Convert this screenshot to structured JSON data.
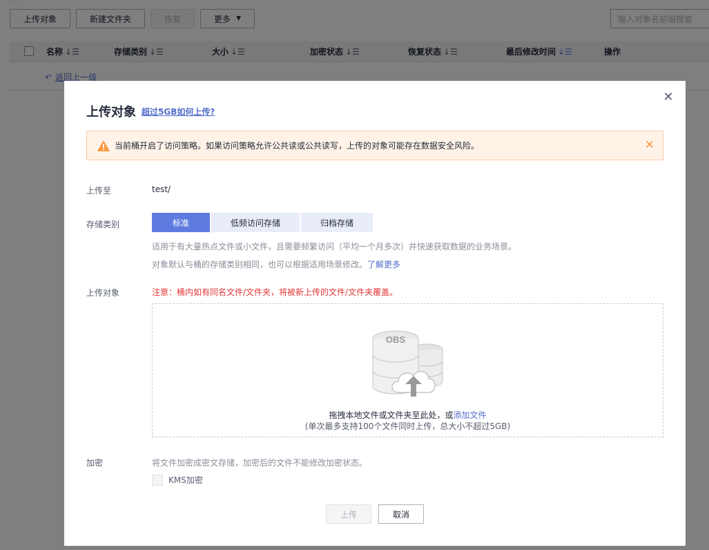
{
  "page": {
    "top_text": "...",
    "toolbar": {
      "upload_label": "上传对象",
      "new_folder_label": "新建文件夹",
      "restore_label": "恢复",
      "more_label": "更多"
    },
    "search_placeholder": "输入对象名前缀搜索",
    "table_headers": [
      "名称",
      "存储类别",
      "大小",
      "加密状态",
      "恢复状态",
      "最后修改时间",
      "操作"
    ],
    "back_link": "返回上一级"
  },
  "dialog": {
    "title": "上传对象",
    "help_link": "超过5GB如何上传?",
    "alert_text": "当前桶开启了访问策略。如果访问策略允许公共读或公共读写，上传的对象可能存在数据安全风险。",
    "upload_to_label": "上传至",
    "upload_to_value": "test/",
    "storage_class_label": "存储类别",
    "storage_options": [
      "标准",
      "低频访问存储",
      "归档存储"
    ],
    "storage_selected": "标准",
    "storage_hint_1": "适用于有大量热点文件或小文件，且需要频繁访问（平均一个月多次）并快速获取数据的业务场景。",
    "storage_hint_2": "对象默认与桶的存储类别相同，也可以根据适用场景修改。",
    "learn_more": "了解更多",
    "upload_object_label": "上传对象",
    "overwrite_warning": "注意：桶内如有同名文件/文件夹，将被新上传的文件/文件夹覆盖。",
    "dropzone_text": "拖拽本地文件或文件夹至此处，或",
    "dropzone_link": "添加文件",
    "dropzone_limit": "(单次最多支持100个文件同时上传，总大小不超过5GB)",
    "dropzone_art_text": "OBS",
    "encryption_label": "加密",
    "encryption_hint": "将文件加密成密文存储，加密后的文件不能修改加密状态。",
    "kms_label": "KMS加密",
    "upload_button": "上传",
    "cancel_button": "取消"
  },
  "colors": {
    "primary": "#5e7ce0",
    "link": "#526ecc",
    "warning": "#fa9841",
    "error": "#e43838"
  }
}
